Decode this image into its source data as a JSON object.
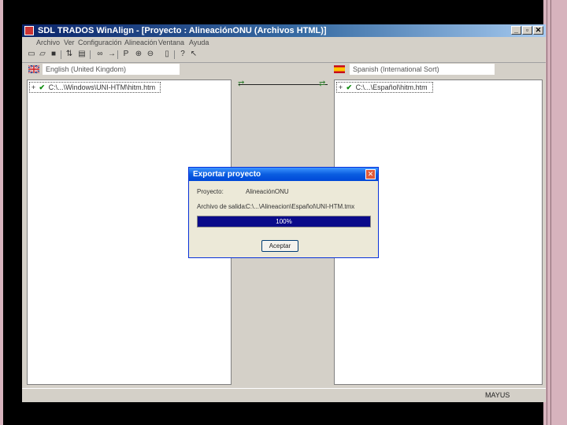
{
  "window": {
    "title": "SDL TRADOS WinAlign - [Proyecto : AlineaciónONU (Archivos HTML)]",
    "controls": {
      "minimize": "_",
      "restore": "▫",
      "close": "✕"
    }
  },
  "menu": [
    "Archivo",
    "Ver",
    "Configuración",
    "Alineación",
    "Ventana",
    "Ayuda"
  ],
  "toolbar": {
    "icons": [
      "new-icon",
      "open-icon",
      "save-icon",
      "properties-icon",
      "print-icon",
      "binoculars-icon",
      "align-icon",
      "pointer-icon",
      "zoom-in-icon",
      "zoom-out-icon",
      "page-icon",
      "help-icon",
      "context-help-icon"
    ]
  },
  "source": {
    "language": "English (United Kingdom)",
    "file": "C:\\...\\Windows\\UNI-HTM\\hitm.htm",
    "expand": "+",
    "check": "✔"
  },
  "target": {
    "language": "Spanish (International Sort)",
    "file": "C:\\...\\Español\\hitm.htm",
    "expand": "+",
    "check": "✔"
  },
  "dialog": {
    "title": "Exportar proyecto",
    "project_label": "Proyecto:",
    "project_value": "AlineaciónONU",
    "output_label": "Archivo de salida:",
    "output_value": "C:\\...\\Alineacion\\Español\\UNI-HTM.tmx",
    "progress_label": "100%",
    "progress_fraction": 1.0,
    "ok_label": "Aceptar",
    "close": "✕"
  },
  "status": {
    "caps": "MAYUS"
  },
  "colors": {
    "titlebar_start": "#0a246a",
    "dialog_title": "#0a5de0",
    "progress_fill": "#0a0a8a",
    "check_green": "#0a8a0a",
    "slide_border": "#d7b3bd"
  }
}
